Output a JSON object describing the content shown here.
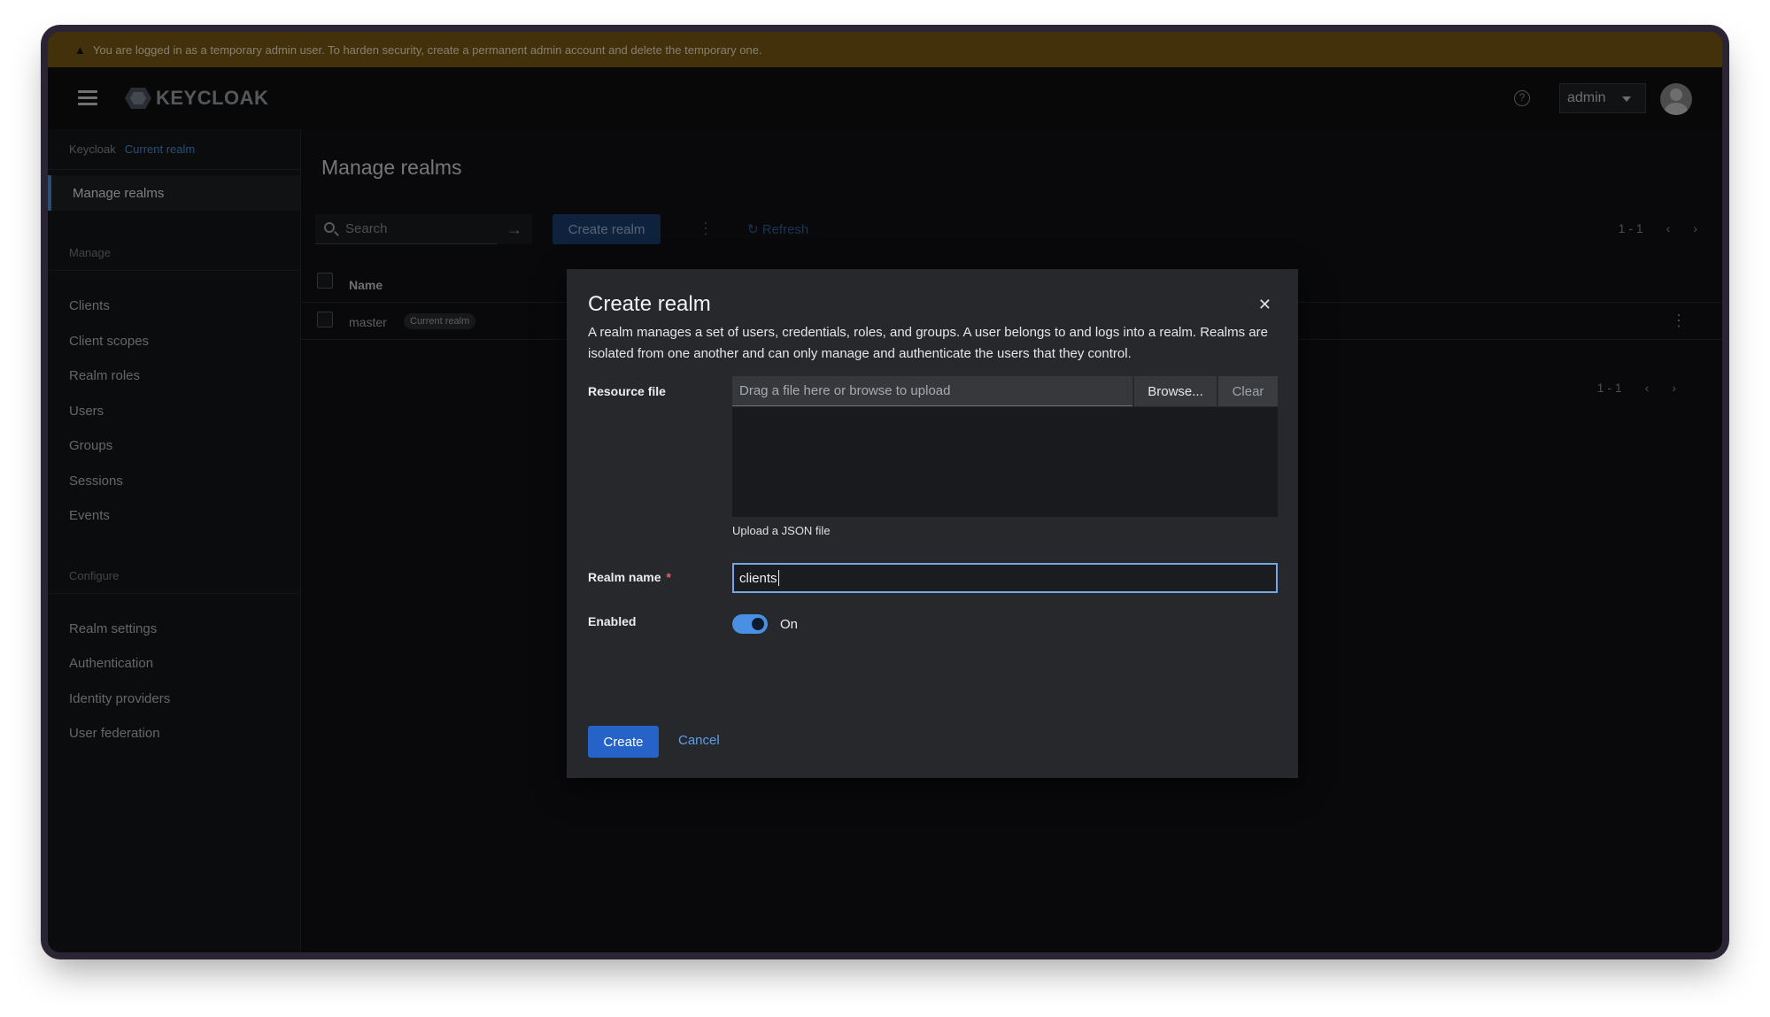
{
  "banner": {
    "text": "You are logged in as a temporary admin user. To harden security, create a permanent admin account and delete the temporary one."
  },
  "masthead": {
    "brand": "KEYCLOAK",
    "user": "admin"
  },
  "sidebar": {
    "crumb_root": "Keycloak",
    "crumb_tag": "Current realm",
    "active_item": "Manage realms",
    "manage_heading": "Manage",
    "manage_items": [
      "Clients",
      "Client scopes",
      "Realm roles",
      "Users",
      "Groups",
      "Sessions",
      "Events"
    ],
    "configure_heading": "Configure",
    "configure_items": [
      "Realm settings",
      "Authentication",
      "Identity providers",
      "User federation"
    ]
  },
  "main": {
    "title": "Manage realms",
    "search_placeholder": "Search",
    "create_realm_label": "Create realm",
    "refresh_label": "Refresh",
    "pagination": "1 - 1",
    "column_name": "Name",
    "rows": [
      {
        "name": "master",
        "tag": "Current realm"
      }
    ]
  },
  "modal": {
    "title": "Create realm",
    "description": "A realm manages a set of users, credentials, roles, and groups. A user belongs to and logs into a realm. Realms are isolated from one another and can only manage and authenticate the users that they control.",
    "resource_file_label": "Resource file",
    "file_placeholder": "Drag a file here or browse to upload",
    "browse_label": "Browse...",
    "clear_label": "Clear",
    "helper_text": "Upload a JSON file",
    "realm_name_label": "Realm name",
    "required_mark": "*",
    "realm_name_value": "clients",
    "enabled_label": "Enabled",
    "enabled_state": "On",
    "create_label": "Create",
    "cancel_label": "Cancel"
  },
  "colors": {
    "accent": "#2563c9",
    "banner": "#7a5a14",
    "toggle": "#4a90e2"
  }
}
